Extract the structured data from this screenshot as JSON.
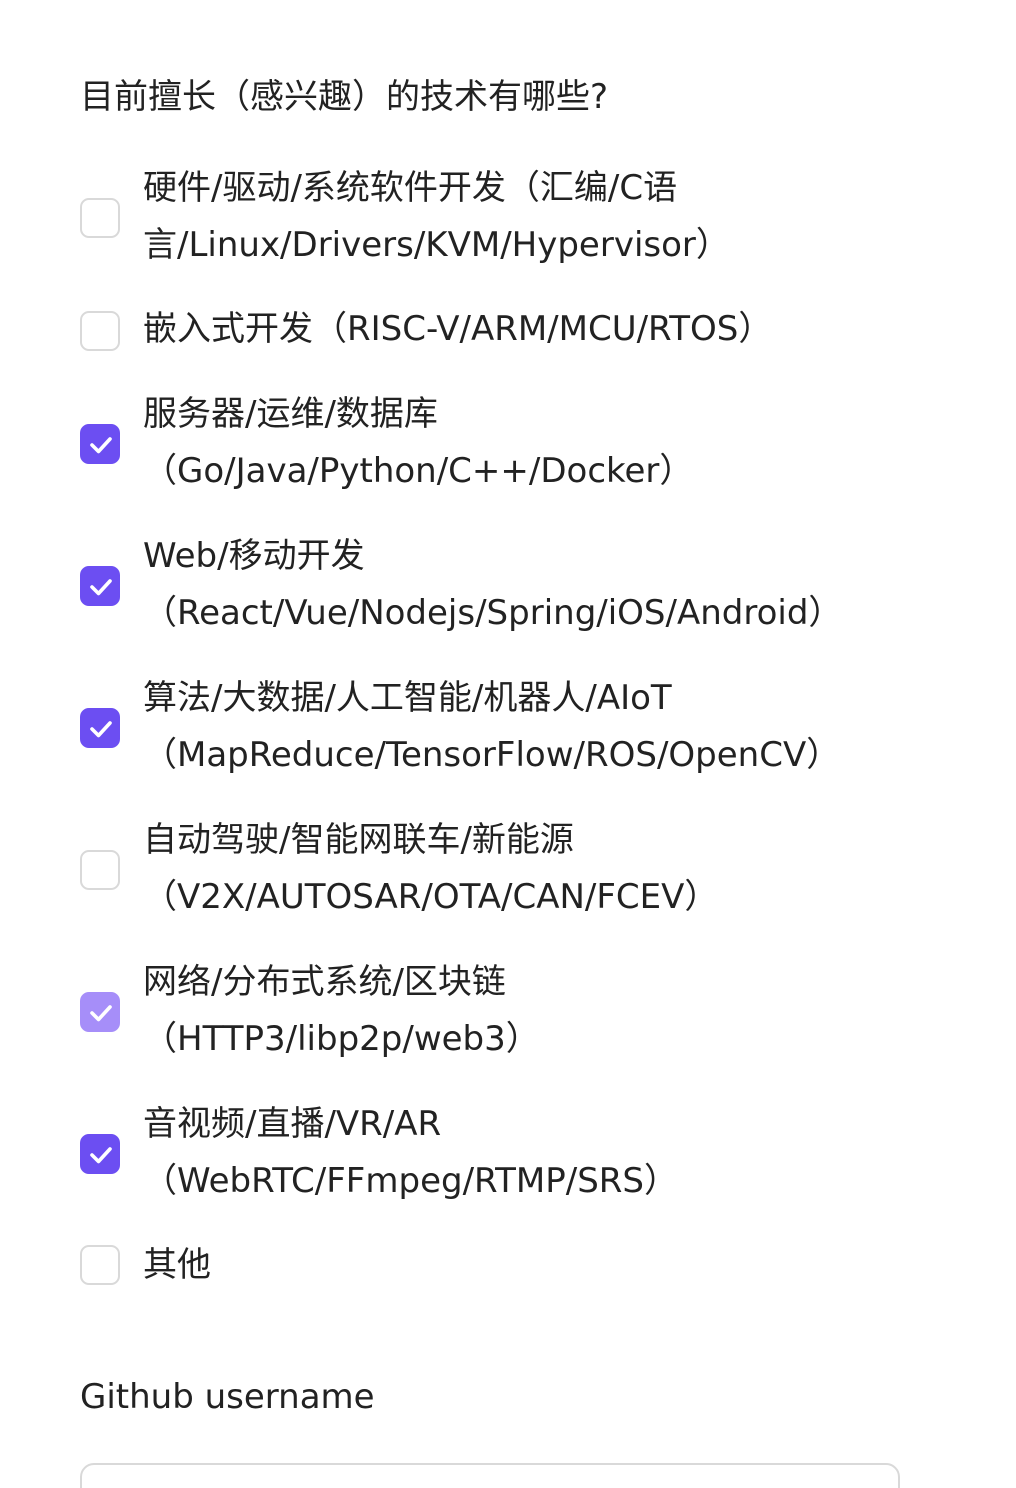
{
  "question": "目前擅长（感兴趣）的技术有哪些?",
  "options": [
    {
      "line1": "硬件/驱动/系统软件开发（汇编/C语",
      "line2": "言/Linux/Drivers/KVM/Hypervisor）",
      "checked": false
    },
    {
      "line1": "嵌入式开发（RISC-V/ARM/MCU/RTOS）",
      "line2": "",
      "checked": false
    },
    {
      "line1": "服务器/运维/数据库",
      "line2": "（Go/Java/Python/C++/Docker）",
      "checked": true
    },
    {
      "line1": "Web/移动开发",
      "line2": "（React/Vue/Nodejs/Spring/iOS/Android）",
      "checked": true
    },
    {
      "line1": "算法/大数据/人工智能/机器人/AIoT",
      "line2": "（MapReduce/TensorFlow/ROS/OpenCV）",
      "checked": true
    },
    {
      "line1": "自动驾驶/智能网联车/新能源",
      "line2": "（V2X/AUTOSAR/OTA/CAN/FCEV）",
      "checked": false
    },
    {
      "line1": "网络/分布式系统/区块链",
      "line2": "（HTTP3/libp2p/web3）",
      "checked": true
    },
    {
      "line1": "音视频/直播/VR/AR",
      "line2": "（WebRTC/FFmpeg/RTMP/SRS）",
      "checked": true
    },
    {
      "line1": "其他",
      "line2": "",
      "checked": false
    }
  ],
  "github": {
    "label": "Github username",
    "value": "",
    "placeholder": ""
  },
  "colors": {
    "accent": "#6c4ef2",
    "accent_light": "#a68ef9",
    "checkbox_border": "#d9d9d9",
    "text": "#222222"
  }
}
